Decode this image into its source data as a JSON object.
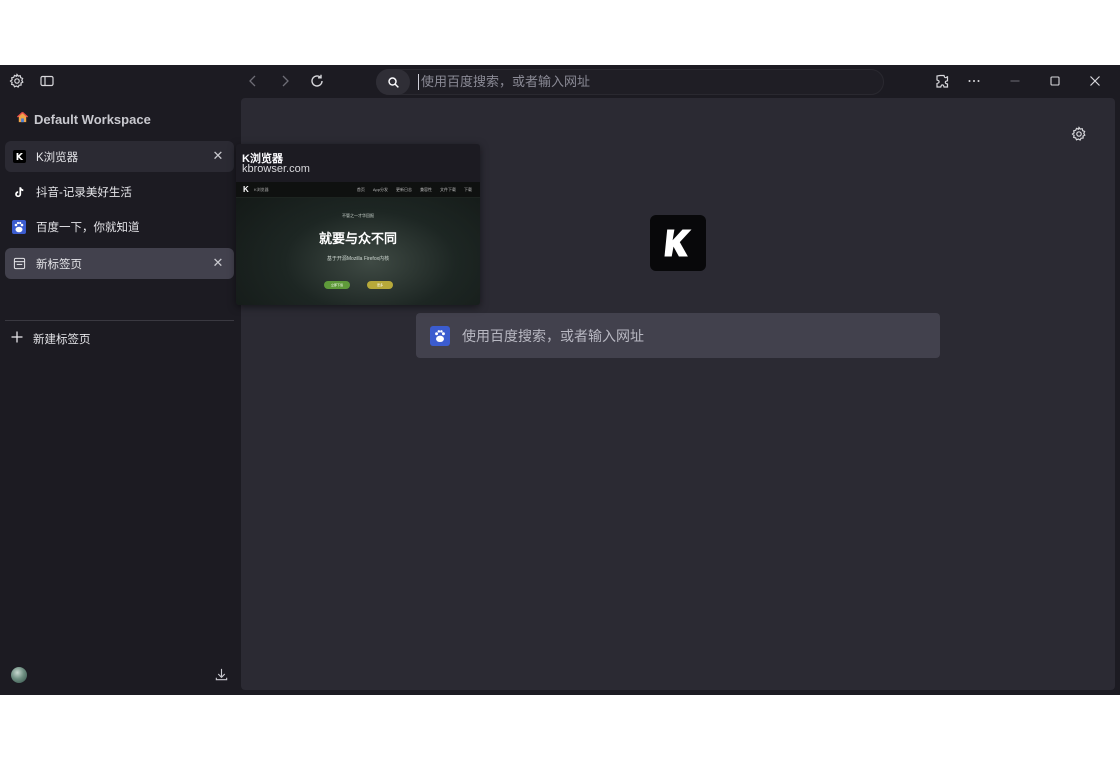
{
  "toolbar": {
    "url_placeholder": "使用百度搜索，或者输入网址"
  },
  "sidebar": {
    "workspace": "Default Workspace",
    "tabs": [
      {
        "label": "K浏览器",
        "icon": "k-browser-icon",
        "state": "active"
      },
      {
        "label": "抖音-记录美好生活",
        "icon": "tiktok-icon",
        "state": "normal"
      },
      {
        "label": "百度一下，你就知道",
        "icon": "baidu-icon",
        "state": "normal"
      },
      {
        "label": "新标签页",
        "icon": "new-tab-icon",
        "state": "selected"
      }
    ],
    "new_tab_label": "新建标签页"
  },
  "preview": {
    "title": "K浏览器",
    "url": "kbrowser.com",
    "site_brand": "K浏览器",
    "site_links": [
      "首页",
      "App分发",
      "更新日志",
      "兼容性",
      "文件下载",
      "下载"
    ],
    "tagline": "不管之一才华回报",
    "headline": "就要与众不同",
    "subline": "基于开源Mozilla Firefox内核",
    "btn1": "立即下载",
    "btn2": "更多"
  },
  "main": {
    "search_placeholder": "使用百度搜索，或者输入网址"
  },
  "colors": {
    "window_bg": "#1c1b22",
    "content_bg": "#2b2a33",
    "search_bg": "#42414d",
    "baidu_blue": "#3b5ccf"
  }
}
